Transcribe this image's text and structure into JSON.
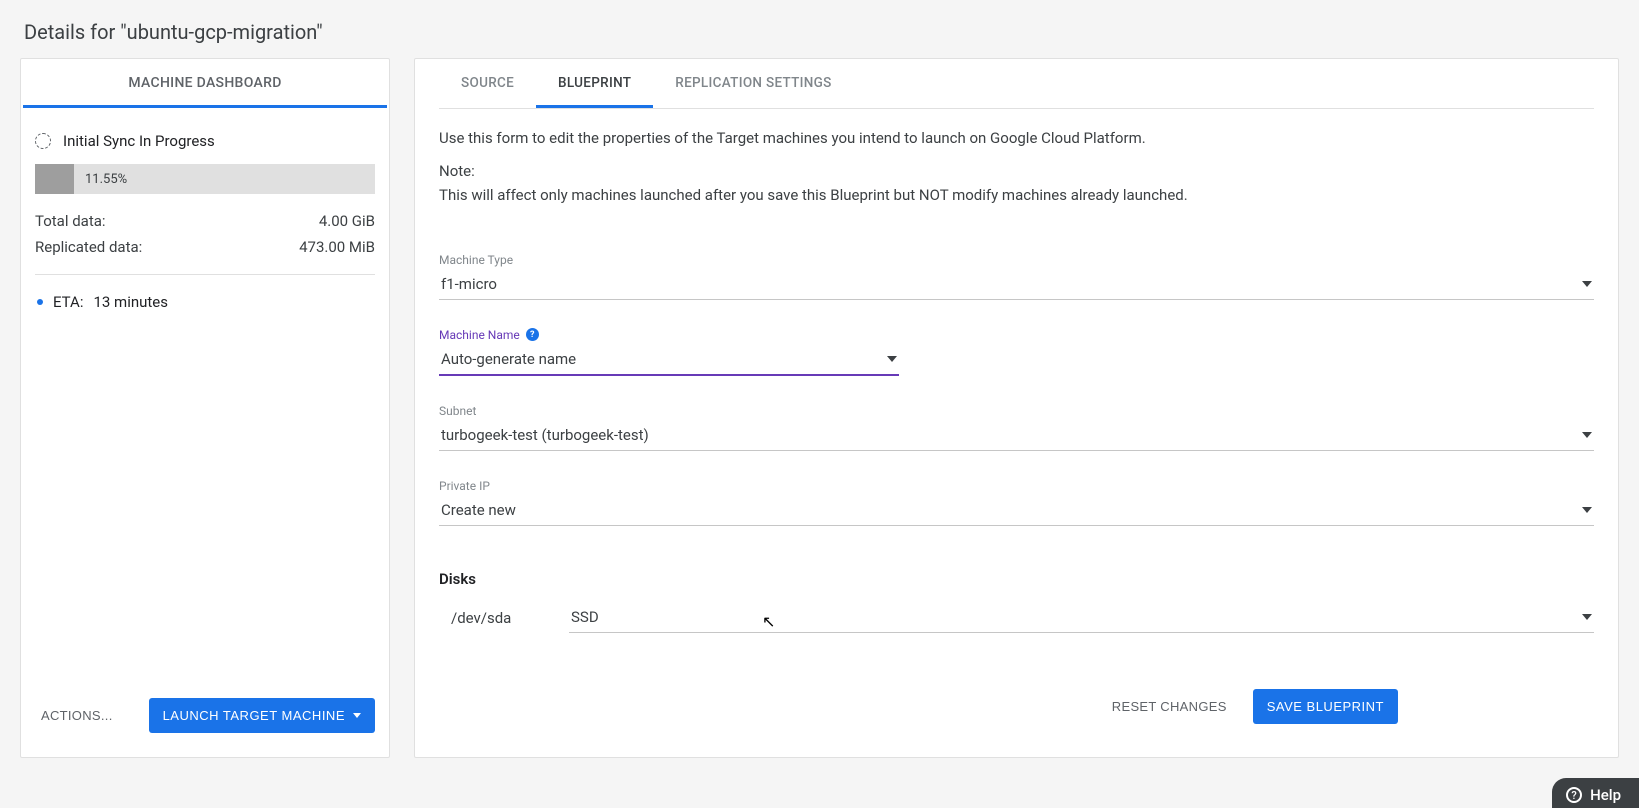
{
  "pageTitle": "Details for \"ubuntu-gcp-migration\"",
  "left": {
    "tabLabel": "MACHINE DASHBOARD",
    "statusText": "Initial Sync In Progress",
    "progressPercentLabel": "11.55%",
    "totalData": {
      "label": "Total data:",
      "value": "4.00 GiB"
    },
    "replicatedData": {
      "label": "Replicated data:",
      "value": "473.00 MiB"
    },
    "eta": {
      "label": "ETA:",
      "value": "13 minutes"
    },
    "actionsLabel": "ACTIONS...",
    "launchLabel": "LAUNCH TARGET MACHINE"
  },
  "right": {
    "tabs": {
      "source": "SOURCE",
      "blueprint": "BLUEPRINT",
      "replication": "REPLICATION SETTINGS"
    },
    "intro": "Use this form to edit the properties of the Target machines you intend to launch on Google Cloud Platform.",
    "noteLabel": "Note:",
    "noteBody": "This will affect only machines launched after you save this Blueprint but NOT modify machines already launched.",
    "fields": {
      "machineType": {
        "label": "Machine Type",
        "value": "f1-micro"
      },
      "machineName": {
        "label": "Machine Name",
        "value": "Auto-generate name"
      },
      "subnet": {
        "label": "Subnet",
        "value": "turbogeek-test (turbogeek-test)"
      },
      "privateIp": {
        "label": "Private IP",
        "value": "Create new"
      }
    },
    "disksHeading": "Disks",
    "disks": [
      {
        "device": "/dev/sda",
        "type": "SSD"
      }
    ],
    "resetLabel": "RESET CHANGES",
    "saveLabel": "SAVE BLUEPRINT"
  },
  "helpLabel": "Help"
}
